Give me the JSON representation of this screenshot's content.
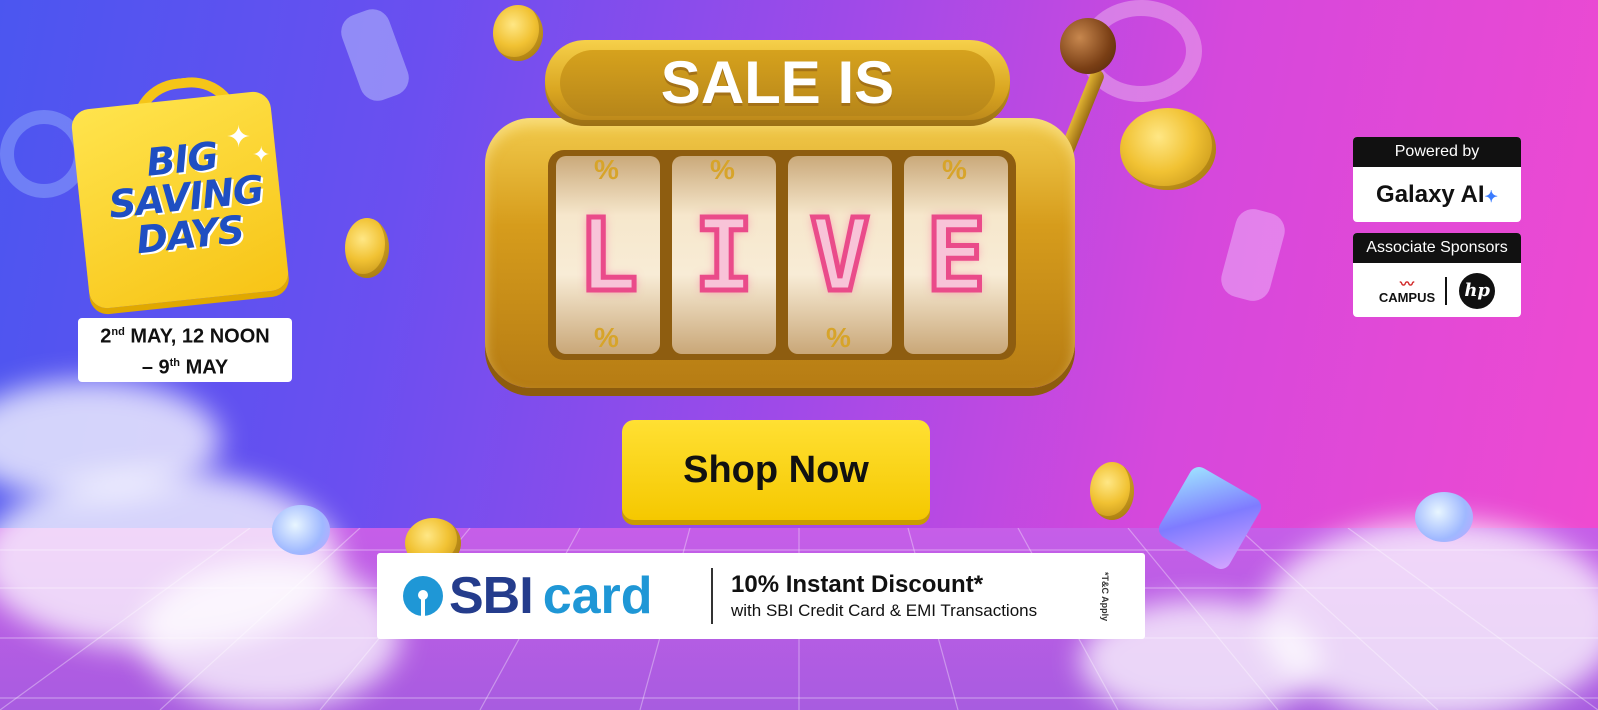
{
  "banner": {
    "brand": {
      "logo_lines": [
        "BIG",
        "SAVING",
        "DAYS"
      ],
      "date_line1_day": "2",
      "date_line1_suffix": "nd",
      "date_line1_rest": " MAY, 12 NOON",
      "date_line2_prefix": "– 9",
      "date_line2_suffix": "th",
      "date_line2_rest": " MAY"
    },
    "headline": {
      "top": "SALE IS",
      "reels": [
        "L",
        "I",
        "V",
        "E"
      ],
      "reel_symbol": "%"
    },
    "cta": {
      "label": "Shop Now"
    },
    "sponsors": {
      "powered_label": "Powered by",
      "powered_brand": "Galaxy AI",
      "associate_label": "Associate Sponsors",
      "associate_brands": [
        "CAMPUS",
        "hp"
      ]
    },
    "offer": {
      "bank_name": "SBI",
      "bank_card": "card",
      "headline": "10% Instant Discount*",
      "subline": "with SBI Credit Card & EMI Transactions",
      "tnc": "*T&C Apply"
    },
    "colors": {
      "cta_yellow": "#f5c800",
      "neon_pink": "#ea4b8a",
      "sbi_blue": "#1f97d6",
      "sbi_navy": "#243c8c",
      "logo_blue": "#1f4fc2"
    }
  }
}
